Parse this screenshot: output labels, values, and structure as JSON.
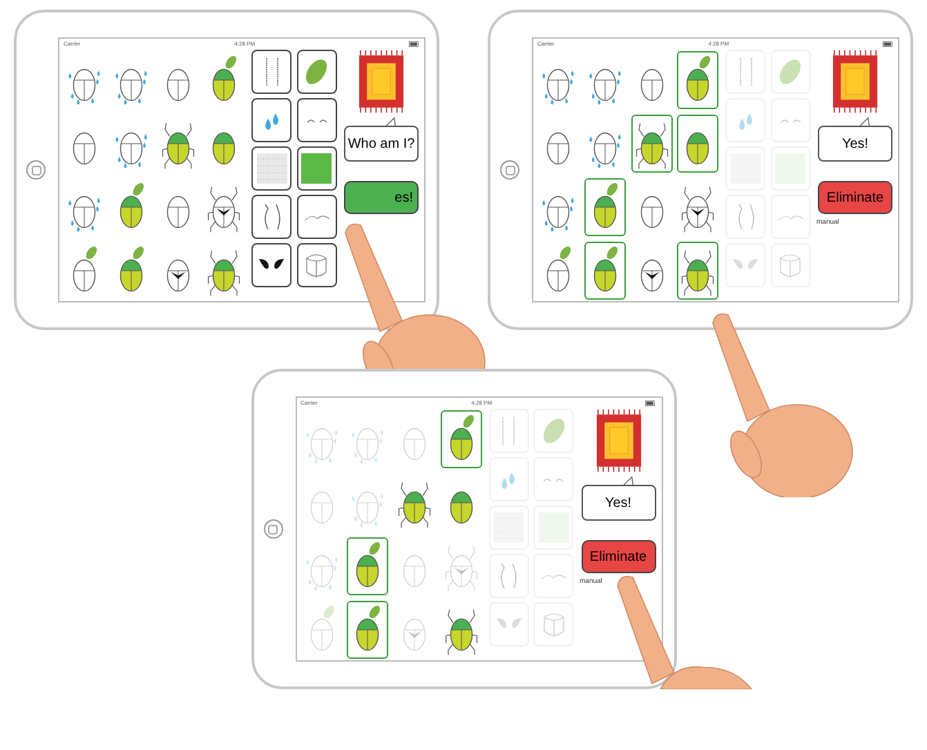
{
  "tablets": [
    {
      "status": {
        "carrier": "Carrier",
        "time": "4:28 PM"
      },
      "tiles_dimmed": false,
      "beetles": [
        {
          "kind": "drops",
          "selected": false,
          "faded": false
        },
        {
          "kind": "drops",
          "selected": false,
          "faded": false
        },
        {
          "kind": "plain",
          "selected": false,
          "faded": false
        },
        {
          "kind": "green-leaf",
          "selected": false,
          "faded": false
        },
        {
          "kind": "plain",
          "selected": false,
          "faded": false
        },
        {
          "kind": "drops",
          "selected": false,
          "faded": false
        },
        {
          "kind": "green-legs",
          "selected": false,
          "faded": false
        },
        {
          "kind": "green",
          "selected": false,
          "faded": false
        },
        {
          "kind": "drops",
          "selected": false,
          "faded": false
        },
        {
          "kind": "green-leaf",
          "selected": false,
          "faded": false
        },
        {
          "kind": "plain",
          "selected": false,
          "faded": false
        },
        {
          "kind": "mark-legs",
          "selected": false,
          "faded": false
        },
        {
          "kind": "leaf",
          "selected": false,
          "faded": false
        },
        {
          "kind": "green-leaf",
          "selected": false,
          "faded": false
        },
        {
          "kind": "mark",
          "selected": false,
          "faded": false
        },
        {
          "kind": "green-legs",
          "selected": false,
          "faded": false
        }
      ],
      "tiles": [
        {
          "kind": "stripes"
        },
        {
          "kind": "leaf"
        },
        {
          "kind": "drops"
        },
        {
          "kind": "eyes"
        },
        {
          "kind": "dots"
        },
        {
          "kind": "green"
        },
        {
          "kind": "antennae"
        },
        {
          "kind": "curve"
        },
        {
          "kind": "black"
        },
        {
          "kind": "shell"
        }
      ],
      "bubble": "Who am I?",
      "button": {
        "kind": "confirm",
        "label": "es!"
      }
    },
    {
      "status": {
        "carrier": "Carrier",
        "time": "4:28 PM"
      },
      "tiles_dimmed": true,
      "beetles": [
        {
          "kind": "drops",
          "selected": false,
          "faded": false
        },
        {
          "kind": "drops",
          "selected": false,
          "faded": false
        },
        {
          "kind": "plain",
          "selected": false,
          "faded": false
        },
        {
          "kind": "green-leaf",
          "selected": true,
          "faded": false
        },
        {
          "kind": "plain",
          "selected": false,
          "faded": false
        },
        {
          "kind": "drops",
          "selected": false,
          "faded": false
        },
        {
          "kind": "green-legs",
          "selected": true,
          "faded": false
        },
        {
          "kind": "green",
          "selected": true,
          "faded": false
        },
        {
          "kind": "drops",
          "selected": false,
          "faded": false
        },
        {
          "kind": "green-leaf",
          "selected": true,
          "faded": false
        },
        {
          "kind": "plain",
          "selected": false,
          "faded": false
        },
        {
          "kind": "mark-legs",
          "selected": false,
          "faded": false
        },
        {
          "kind": "leaf",
          "selected": false,
          "faded": false
        },
        {
          "kind": "green-leaf",
          "selected": true,
          "faded": false
        },
        {
          "kind": "mark",
          "selected": false,
          "faded": false
        },
        {
          "kind": "green-legs",
          "selected": true,
          "faded": false
        }
      ],
      "tiles": [
        {
          "kind": "stripes"
        },
        {
          "kind": "leaf"
        },
        {
          "kind": "drops"
        },
        {
          "kind": "eyes"
        },
        {
          "kind": "dots"
        },
        {
          "kind": "green"
        },
        {
          "kind": "antennae"
        },
        {
          "kind": "curve"
        },
        {
          "kind": "black"
        },
        {
          "kind": "shell"
        }
      ],
      "bubble": "Yes!",
      "button": {
        "kind": "eliminate",
        "label": "Eliminate"
      },
      "note": "manual"
    },
    {
      "status": {
        "carrier": "Carrier",
        "time": "4:28 PM"
      },
      "tiles_dimmed": true,
      "beetles": [
        {
          "kind": "drops",
          "selected": false,
          "faded": true
        },
        {
          "kind": "drops",
          "selected": false,
          "faded": true
        },
        {
          "kind": "plain",
          "selected": false,
          "faded": true
        },
        {
          "kind": "green-leaf",
          "selected": true,
          "faded": false
        },
        {
          "kind": "plain",
          "selected": false,
          "faded": true
        },
        {
          "kind": "drops",
          "selected": false,
          "faded": true
        },
        {
          "kind": "green-legs",
          "selected": false,
          "faded": false
        },
        {
          "kind": "green",
          "selected": false,
          "faded": false
        },
        {
          "kind": "drops",
          "selected": false,
          "faded": true
        },
        {
          "kind": "green-leaf",
          "selected": true,
          "faded": false
        },
        {
          "kind": "plain",
          "selected": false,
          "faded": true
        },
        {
          "kind": "mark-legs",
          "selected": false,
          "faded": true
        },
        {
          "kind": "leaf",
          "selected": false,
          "faded": true
        },
        {
          "kind": "green-leaf",
          "selected": true,
          "faded": false
        },
        {
          "kind": "mark",
          "selected": false,
          "faded": true
        },
        {
          "kind": "green-legs",
          "selected": false,
          "faded": false
        }
      ],
      "tiles": [
        {
          "kind": "stripes"
        },
        {
          "kind": "leaf"
        },
        {
          "kind": "drops"
        },
        {
          "kind": "eyes"
        },
        {
          "kind": "dots"
        },
        {
          "kind": "green"
        },
        {
          "kind": "antennae"
        },
        {
          "kind": "curve"
        },
        {
          "kind": "black"
        },
        {
          "kind": "shell"
        }
      ],
      "bubble": "Yes!",
      "button": {
        "kind": "eliminate",
        "label": "Eliminate"
      },
      "note": "manual"
    }
  ]
}
